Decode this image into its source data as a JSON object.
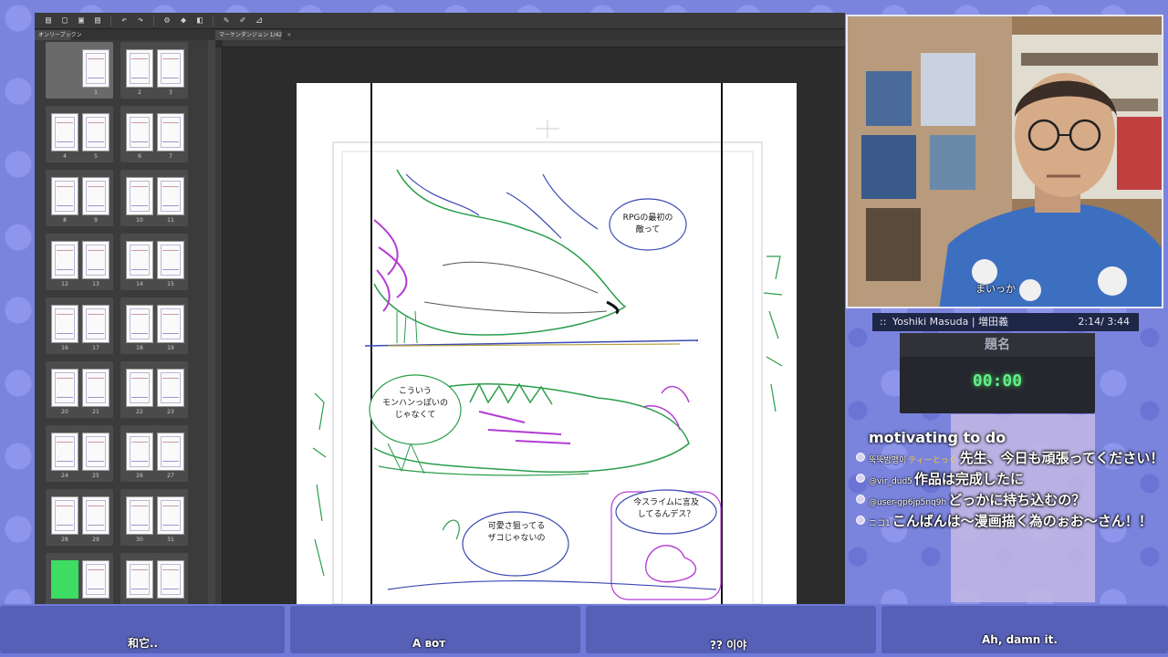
{
  "app": {
    "panel_tab": "オンリーブックン",
    "doc_tab": "マーケンダンジョン 1/42",
    "close_glyph": "×",
    "toolbar_icons": [
      "panel-icon",
      "new-icon",
      "open-icon",
      "save-icon",
      "undo-icon",
      "redo-icon",
      "settings-icon",
      "fill-icon",
      "transform-icon",
      "pen-icon",
      "brush-icon",
      "ruler-icon"
    ],
    "toolbar_glyphs": [
      "▤",
      "▢",
      "▣",
      "▤",
      "↶",
      "↷",
      "⚙",
      "◆",
      "◧",
      "✎",
      "✐",
      "⊿"
    ]
  },
  "pages": [
    {
      "pair": [
        "",
        "1"
      ],
      "left_empty": true,
      "selected": true,
      "green": false
    },
    {
      "pair": [
        "2",
        "3"
      ],
      "left_empty": false,
      "selected": false,
      "green": false
    },
    {
      "pair": [
        "4",
        "5"
      ],
      "left_empty": false,
      "selected": false,
      "green": false
    },
    {
      "pair": [
        "6",
        "7"
      ],
      "left_empty": false,
      "selected": false,
      "green": false
    },
    {
      "pair": [
        "8",
        "9"
      ],
      "left_empty": false,
      "selected": false,
      "green": false
    },
    {
      "pair": [
        "10",
        "11"
      ],
      "left_empty": false,
      "selected": false,
      "green": false
    },
    {
      "pair": [
        "12",
        "13"
      ],
      "left_empty": false,
      "selected": false,
      "green": false
    },
    {
      "pair": [
        "14",
        "15"
      ],
      "left_empty": false,
      "selected": false,
      "green": false
    },
    {
      "pair": [
        "16",
        "17"
      ],
      "left_empty": false,
      "selected": false,
      "green": false
    },
    {
      "pair": [
        "18",
        "19"
      ],
      "left_empty": false,
      "selected": false,
      "green": false
    },
    {
      "pair": [
        "20",
        "21"
      ],
      "left_empty": false,
      "selected": false,
      "green": false
    },
    {
      "pair": [
        "22",
        "23"
      ],
      "left_empty": false,
      "selected": false,
      "green": false
    },
    {
      "pair": [
        "24",
        "25"
      ],
      "left_empty": false,
      "selected": false,
      "green": false
    },
    {
      "pair": [
        "26",
        "27"
      ],
      "left_empty": false,
      "selected": false,
      "green": false
    },
    {
      "pair": [
        "28",
        "29"
      ],
      "left_empty": false,
      "selected": false,
      "green": false
    },
    {
      "pair": [
        "30",
        "31"
      ],
      "left_empty": false,
      "selected": false,
      "green": false
    },
    {
      "pair": [
        "",
        ""
      ],
      "left_empty": false,
      "selected": false,
      "green": true
    },
    {
      "pair": [
        "",
        ""
      ],
      "left_empty": false,
      "selected": false,
      "green": false
    }
  ],
  "canvas": {
    "bubbles": {
      "b1": "RPGの最初の\n敵って",
      "b2": "こういう\nモンハンっぽいの\nじゃなくて",
      "b3": "可愛さ狙ってる\nザコじゃないの",
      "b4": "今スライムに言及\nしてるんデス？"
    }
  },
  "webcam": {
    "subtitle": "まいっか"
  },
  "music": {
    "dots": "::",
    "title": "Yoshiki Masuda | 増田義",
    "time": "2:14/ 3:44"
  },
  "timer": {
    "title": "題名",
    "time": "00:00"
  },
  "chat": {
    "header": "motivating to do",
    "messages": [
      {
        "user": "뚝뚝방맹이",
        "badge": "ティーとっぐ",
        "text": "先生、今日も頑張ってください！"
      },
      {
        "user": "@vir_dud5",
        "badge": "",
        "text": "作品は完成したに"
      },
      {
        "user": "@user-gp6jp5nq9h",
        "badge": "",
        "text": "どっかに持ち込むの？"
      },
      {
        "user": "ニコ1",
        "badge": "",
        "text": "こんばんは〜漫画描く為のぉお〜さん！！"
      }
    ]
  },
  "captions": [
    "和它..",
    "А вот",
    "?? 이야",
    "Ah, damn it."
  ],
  "colors": {
    "accent_purple": "#7a84dd",
    "timer_green": "#66ee88",
    "sketch_purple": "#b43cd4",
    "sketch_green": "#2a9e4a",
    "sketch_blue": "#3a4ab4"
  }
}
